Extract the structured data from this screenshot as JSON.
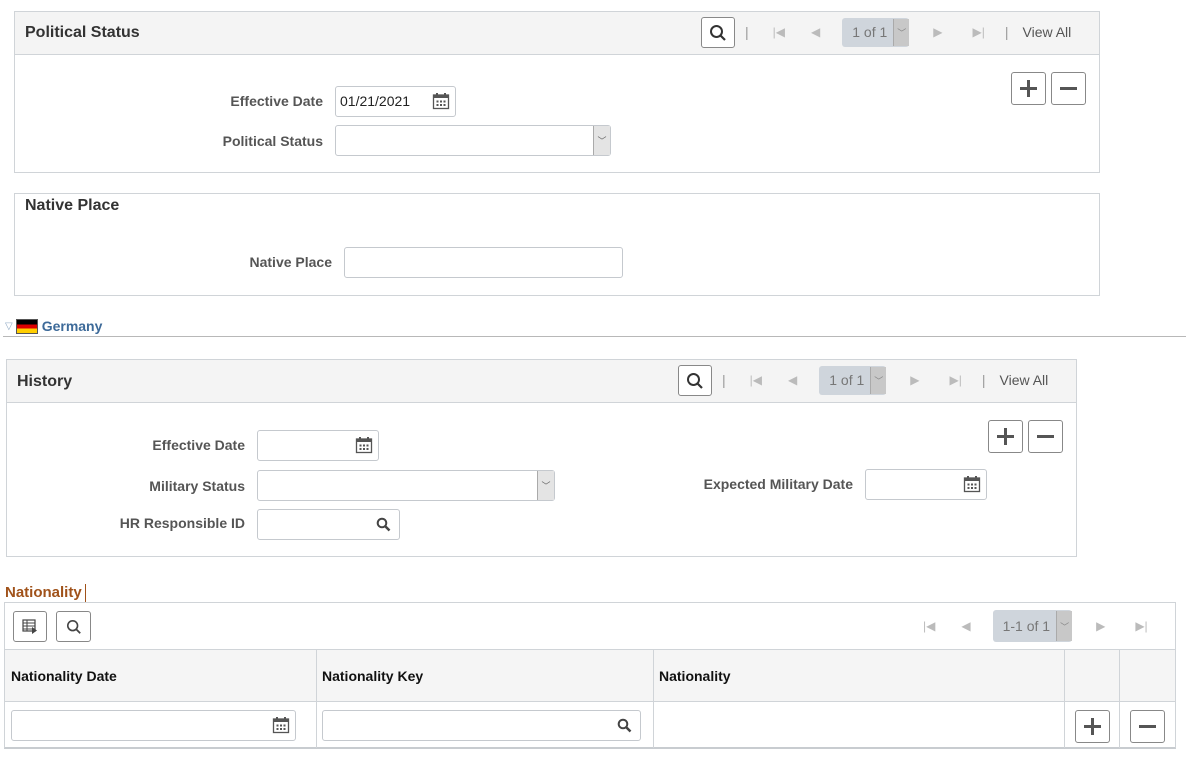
{
  "political_status_panel": {
    "title": "Political Status",
    "nav": {
      "page_label": "1 of 1",
      "view_all": "View All"
    },
    "fields": {
      "effective_date": {
        "label": "Effective Date",
        "value": "01/21/2021"
      },
      "political_status": {
        "label": "Political Status",
        "value": ""
      }
    }
  },
  "native_place_panel": {
    "title": "Native Place",
    "fields": {
      "native_place": {
        "label": "Native Place",
        "value": ""
      }
    }
  },
  "country_section": {
    "label": "Germany",
    "flag_colors": [
      "#000000",
      "#dd0000",
      "#ffce00"
    ],
    "link_color": "#3d6a99"
  },
  "history_panel": {
    "title": "History",
    "nav": {
      "page_label": "1 of 1",
      "view_all": "View All"
    },
    "fields": {
      "effective_date": {
        "label": "Effective Date",
        "value": ""
      },
      "military_status": {
        "label": "Military Status",
        "value": ""
      },
      "hr_responsible_id": {
        "label": "HR Responsible ID",
        "value": ""
      },
      "expected_military_date": {
        "label": "Expected Military Date",
        "value": ""
      }
    }
  },
  "nationality_grid": {
    "title": "Nationality",
    "title_color": "#a0521a",
    "pager_label": "1-1 of 1",
    "columns": [
      "Nationality Date",
      "Nationality Key",
      "Nationality"
    ],
    "rows": [
      {
        "nationality_date": "",
        "nationality_key": "",
        "nationality": ""
      }
    ]
  }
}
